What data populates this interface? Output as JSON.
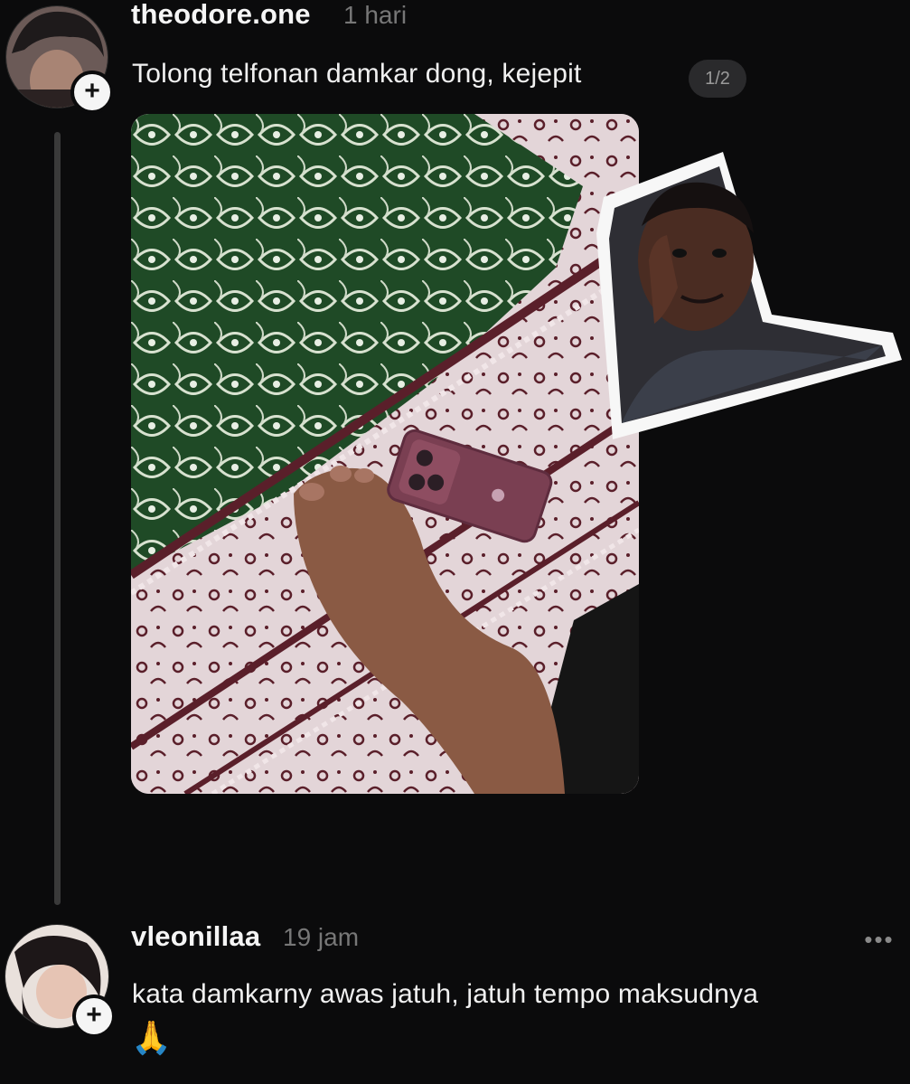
{
  "post": {
    "username": "theodore.one",
    "time": "1 hari",
    "text": "Tolong telfonan damkar dong, kejepit",
    "image_counter": "1/2",
    "follow_icon": "plus-icon",
    "photo": "rug-foot-phone-photo",
    "sticker": "thinking-man-meme-sticker"
  },
  "reply": {
    "username": "vleonillaa",
    "time": "19 jam",
    "text": "kata damkarny awas jatuh, jatuh tempo maksudnya",
    "emoji": "🙏",
    "follow_icon": "plus-icon",
    "more_icon": "more-options-icon"
  },
  "colors": {
    "background": "#0b0b0c",
    "text": "#f3f3f3",
    "muted": "#777777"
  }
}
